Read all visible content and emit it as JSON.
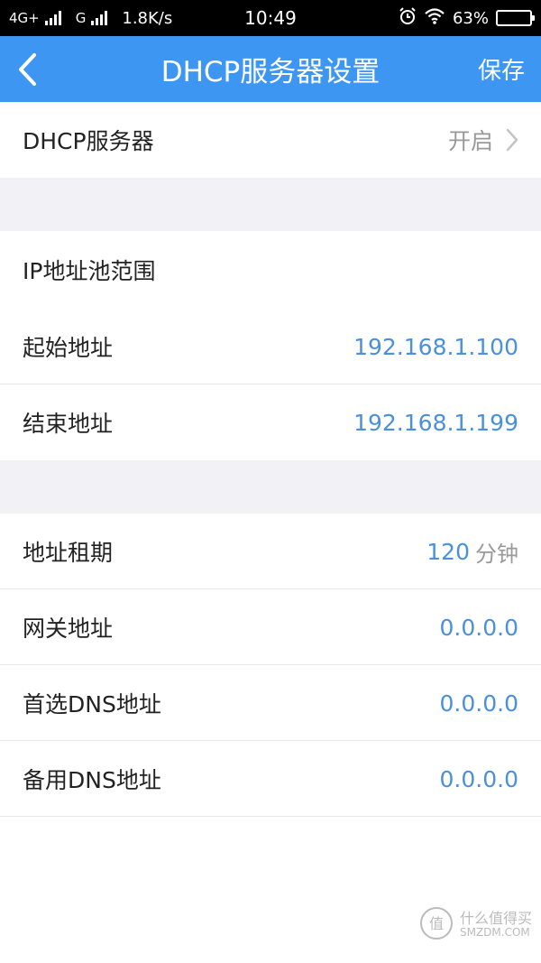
{
  "status_bar": {
    "network1": "4G+",
    "network2": "G",
    "speed": "1.8K/s",
    "time": "10:49",
    "battery": "63%",
    "battery_level": 0.63
  },
  "navbar": {
    "title": "DHCP服务器设置",
    "save_label": "保存"
  },
  "dhcp": {
    "label": "DHCP服务器",
    "value": "开启"
  },
  "pool": {
    "heading": "IP地址池范围",
    "start_label": "起始地址",
    "start_value": "192.168.1.100",
    "end_label": "结束地址",
    "end_value": "192.168.1.199"
  },
  "lease": {
    "label": "地址租期",
    "value": "120",
    "unit": "分钟"
  },
  "gateway": {
    "label": "网关地址",
    "value": "0.0.0.0"
  },
  "dns1": {
    "label": "首选DNS地址",
    "value": "0.0.0.0"
  },
  "dns2": {
    "label": "备用DNS地址",
    "value": "0.0.0.0"
  },
  "watermark": {
    "cn": "什么值得买",
    "en": "SMZDM.COM"
  },
  "colors": {
    "accent": "#3d97f2",
    "value_blue": "#4a90dd",
    "section_gap": "#f2f2f6"
  }
}
